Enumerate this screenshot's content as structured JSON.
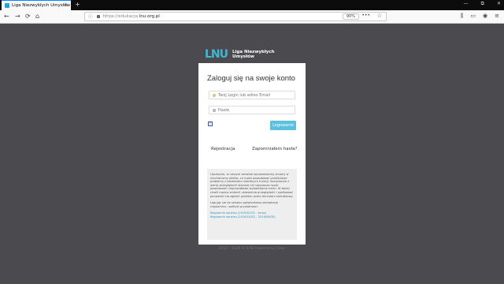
{
  "browser": {
    "tab_title": "Liga Niezwykłych Umysłów",
    "tab_close": "×",
    "new_tab": "+",
    "url_host_prefix": "https://edukacja.",
    "url_domain": "lnu.org.pl",
    "zoom": "90%",
    "more": "•••",
    "star": "☆",
    "window_controls": [
      "—",
      "⧉",
      "✕"
    ],
    "nav": {
      "back": "←",
      "forward": "→",
      "reload": "⟳",
      "home": "⌂"
    },
    "toolbar_icons": [
      "⫼",
      "▭",
      "◉",
      "≡"
    ]
  },
  "logo": {
    "mark": "LNU",
    "line1": "Liga Niezwykłych",
    "line2": "Umysłów"
  },
  "login": {
    "title": "Zaloguj się na swoje konto",
    "login_placeholder": "Twój Login lub adres Email",
    "password_placeholder": "Hasło",
    "fb_icon": "f",
    "login_button": "Logowanie",
    "register_link": "Rejestracja",
    "forgot_link": "Zapomniałem hasła?"
  },
  "info": {
    "paragraph1": "Uprzejmie, w naszym serwisie wprowadzamy zmiany w mechanizmy plików, co może powodować przejściowe problemy z działaniem niektórych funkcji. Korzystanie z wersji przeglądarki starszej niż najnowsza może powodować nieprawidłowe wyświetlanie treści. W takiej chwili można zmienić ustawienia przeglądarki i spróbować ponownie lub zgłosić problem przez formularz kontaktowy.",
    "paragraph2": "Logując się do serwisu potwierdzasz akceptację regulaminu i polityki prywatności.",
    "link1": "Regulamin serwisu (2019/07/01 - teraz)",
    "link2": "Regulamin serwisu (2016/10/01 - 2019/06/30)"
  },
  "footer": "2015 - 2020 © SHB Powered by Elixir"
}
